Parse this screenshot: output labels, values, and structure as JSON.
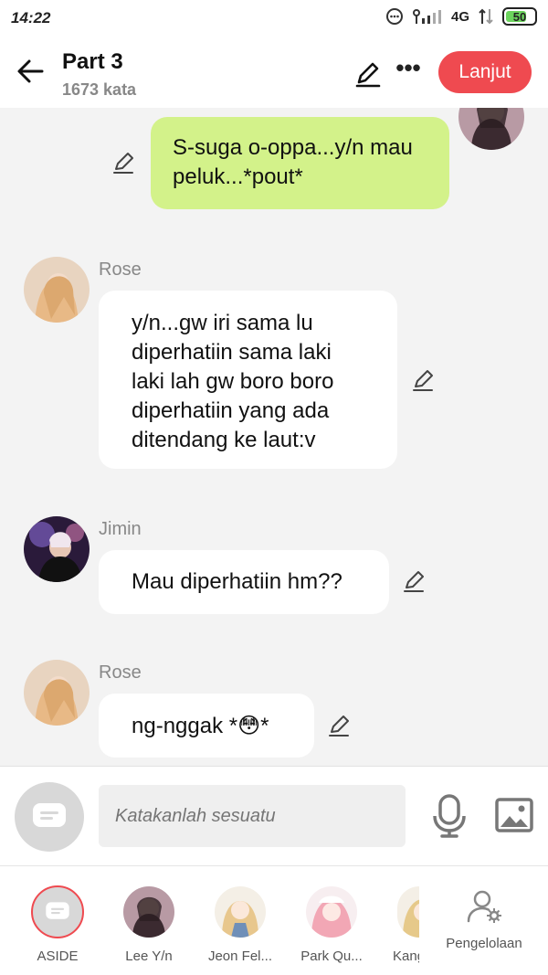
{
  "status": {
    "time": "14:22",
    "network": "4G",
    "battery": "50"
  },
  "header": {
    "title": "Part 3",
    "subtitle": "1673 kata",
    "next_label": "Lanjut"
  },
  "messages": [
    {
      "speaker": "",
      "text": "S-suga o-oppa...y/n mau peluk...*pout*",
      "own": true
    },
    {
      "speaker": "Rose",
      "text": "y/n...gw iri sama lu diperhatiin sama laki laki lah gw boro boro diperhatiin yang ada ditendang ke laut:v"
    },
    {
      "speaker": "Jimin",
      "text": "Mau diperhatiin hm??"
    },
    {
      "speaker": "Rose",
      "text": "ng-nggak *",
      "emoji": "😳",
      "text_after": "*"
    }
  ],
  "input": {
    "placeholder": "Katakanlah sesuatu"
  },
  "characters": [
    {
      "label": "ASIDE",
      "color": "#d8d8d8"
    },
    {
      "label": "Lee Y/n",
      "color": "#4a3a42"
    },
    {
      "label": "Jeon Fel...",
      "color": "#e8c78d"
    },
    {
      "label": "Park Qu...",
      "color": "#f2a7b5"
    },
    {
      "label": "Kang",
      "color": "#e6c98a"
    }
  ],
  "manage_label": "Pengelolaan",
  "colors": {
    "accent": "#ef4a50",
    "own_bubble": "#d3f28a"
  }
}
